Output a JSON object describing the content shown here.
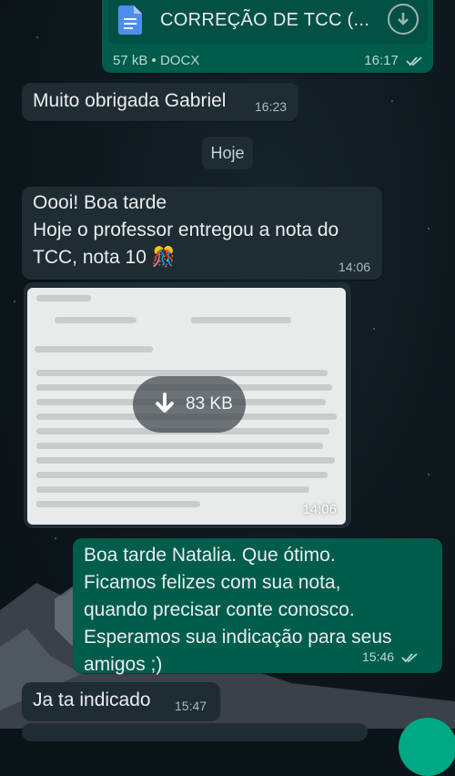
{
  "messages": [
    {
      "type": "document",
      "direction": "out",
      "file_name": "CORREÇÃO DE TCC (...",
      "meta": "57 kB • DOCX",
      "time": "16:17",
      "status": "read",
      "icon": "doc-file-icon"
    },
    {
      "type": "text",
      "direction": "in",
      "text": "Muito obrigada Gabriel",
      "time": "16:23"
    },
    {
      "type": "date",
      "text": "Hoje"
    },
    {
      "type": "text",
      "direction": "in",
      "text": "Oooi! Boa tarde\nHoje o professor entregou a nota do\nTCC, nota 10 🎊",
      "time": "14:06"
    },
    {
      "type": "image",
      "direction": "in",
      "download_label": "83 KB",
      "time": "14:06"
    },
    {
      "type": "text",
      "direction": "out",
      "text": "Boa tarde Natalia. Que ótimo.\nFicamos felizes com sua nota,\nquando precisar conte conosco.\nEsperamos sua indicação para seus\namigos ;)",
      "time": "15:46",
      "status": "read"
    },
    {
      "type": "text",
      "direction": "in",
      "text": "Ja ta indicado",
      "time": "15:47"
    }
  ],
  "colors": {
    "incoming": "#1f2c33",
    "outgoing": "#005c4b",
    "accent": "#00a884",
    "background": "#0b1418"
  }
}
